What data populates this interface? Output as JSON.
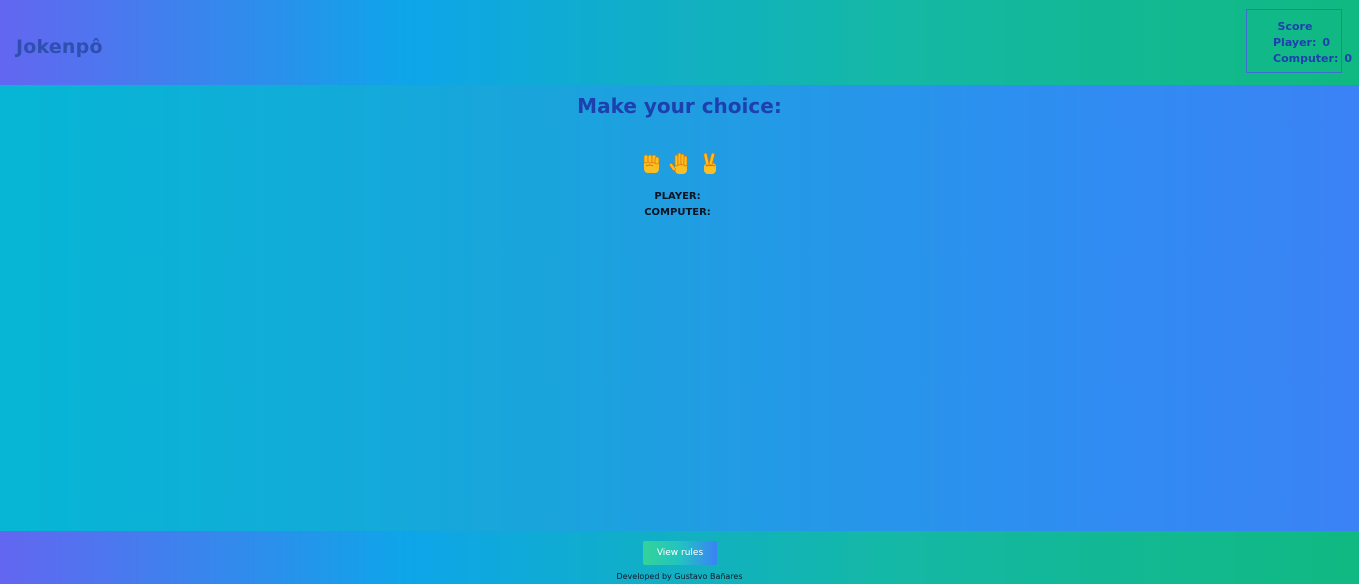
{
  "header": {
    "title": "Jokenpô",
    "score": {
      "title": "Score",
      "player_label": "Player:",
      "player_value": "0",
      "computer_label": "Computer:",
      "computer_value": "0"
    }
  },
  "main": {
    "heading": "Make your choice:",
    "choices": [
      {
        "icon": "rock-fist-icon"
      },
      {
        "icon": "paper-hand-icon"
      },
      {
        "icon": "scissors-victory-icon"
      }
    ],
    "player_label": "PLAYER:",
    "player_choice": "",
    "computer_label": "COMPUTER:",
    "computer_choice": ""
  },
  "footer": {
    "rules_button": "View rules",
    "credits": "Developed by Gustavo Bañares"
  },
  "colors": {
    "accent_dark": "#1e40af",
    "emoji_yellow": "#fbbf24"
  }
}
